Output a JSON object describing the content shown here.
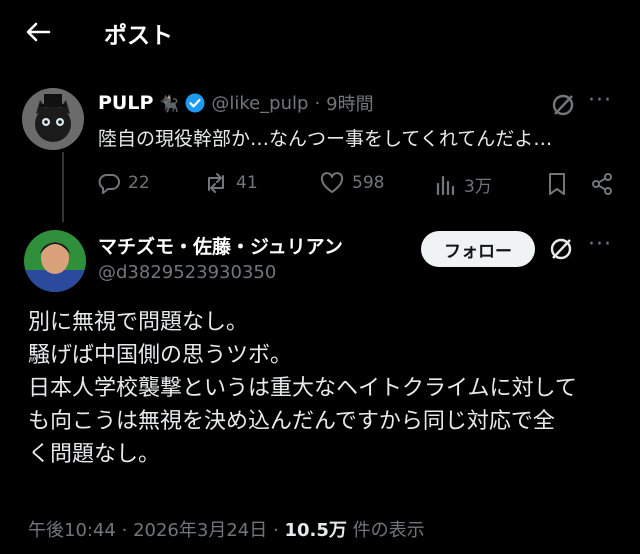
{
  "header": {
    "title": "ポスト"
  },
  "parent": {
    "name": "PULP",
    "handle": "@like_pulp",
    "separator": "·",
    "time": "9時間",
    "text": "陸自の現役幹部か…なんつー事をしてくれてんだよ…",
    "stats": {
      "replies": "22",
      "reposts": "41",
      "likes": "598",
      "views": "3万"
    }
  },
  "reply": {
    "name": "マチズモ・佐藤・ジュリアン",
    "handle": "@d3829523930350",
    "follow_label": "フォロー",
    "lines": [
      "別に無視で問題なし。",
      "騒げば中国側の思うツボ。",
      "日本人学校襲撃というは重大なヘイトクライムに対して",
      "も向こうは無視を決め込んだんですから同じ対応で全",
      "く問題なし。"
    ],
    "time": "午後10:44",
    "sep1": "·",
    "date": "2026年3月24日",
    "sep2": "·",
    "views": "10.5万",
    "views_suffix": "件の表示"
  },
  "colors": {
    "verified": "#1d9bf0",
    "muted": "#71767b",
    "background": "#000000"
  }
}
